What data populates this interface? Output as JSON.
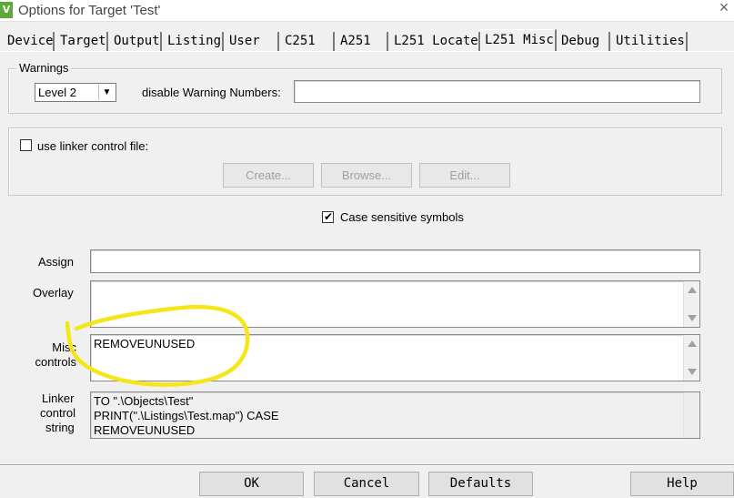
{
  "window": {
    "title": "Options for Target 'Test'",
    "icon": "keil-uvision-icon"
  },
  "tabs": [
    {
      "label": "Device"
    },
    {
      "label": "Target"
    },
    {
      "label": "Output"
    },
    {
      "label": "Listing"
    },
    {
      "label": "User"
    },
    {
      "label": "C251"
    },
    {
      "label": "A251"
    },
    {
      "label": "L251 Locate"
    },
    {
      "label": "L251 Misc",
      "active": true
    },
    {
      "label": "Debug"
    },
    {
      "label": "Utilities"
    }
  ],
  "warnings": {
    "group_label": "Warnings",
    "level_value": "Level 2",
    "disable_label": "disable Warning Numbers:",
    "disable_value": ""
  },
  "linker_control": {
    "checkbox_label": "use linker control file:",
    "checked": false,
    "create_label": "Create...",
    "browse_label": "Browse...",
    "edit_label": "Edit..."
  },
  "case_sensitive": {
    "label": "Case sensitive symbols",
    "checked": true
  },
  "assign": {
    "label": "Assign",
    "value": ""
  },
  "overlay": {
    "label": "Overlay",
    "value": ""
  },
  "misc_controls": {
    "label_line1": "Misc",
    "label_line2": "controls",
    "value": "REMOVEUNUSED"
  },
  "linker_string": {
    "label_line1": "Linker",
    "label_line2": "control",
    "label_line3": "string",
    "lines": [
      "TO \".\\Objects\\Test\"",
      "PRINT(\".\\Listings\\Test.map\") CASE",
      "REMOVEUNUSED"
    ]
  },
  "buttons": {
    "ok": "OK",
    "cancel": "Cancel",
    "defaults": "Defaults",
    "help": "Help"
  },
  "annotation_color": "#f5e61a"
}
